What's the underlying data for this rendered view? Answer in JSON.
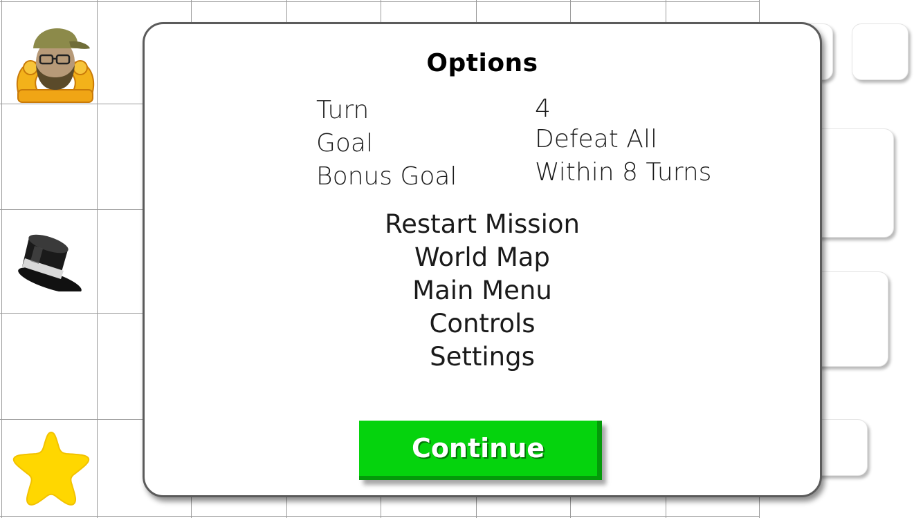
{
  "dialog": {
    "title": "Options",
    "info": {
      "turn_label": "Turn",
      "turn_value": "4",
      "goal_label": "Goal",
      "goal_value": "Defeat All",
      "bonus_goal_label": "Bonus Goal",
      "bonus_goal_value": "Within 8 Turns"
    },
    "menu": {
      "restart_mission": "Restart Mission",
      "world_map": "World Map",
      "main_menu": "Main Menu",
      "controls": "Controls",
      "settings": "Settings"
    },
    "continue_label": "Continue"
  },
  "board": {
    "pieces": [
      "player-avatar",
      "top-hat-icon",
      "star-icon"
    ]
  },
  "colors": {
    "continue_button": "#05d30d",
    "continue_button_edge": "#049a0a",
    "star": "#ffd700",
    "grid_line": "#9a9a9a",
    "modal_border": "#5b5b5b"
  }
}
